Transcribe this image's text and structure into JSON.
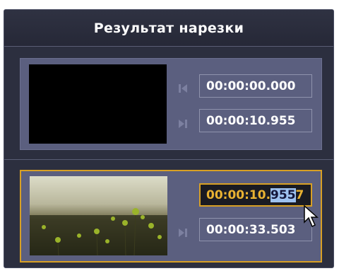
{
  "panel": {
    "title": "Результат нарезки"
  },
  "clips": [
    {
      "start": "00:00:00.000",
      "end": "00:00:10.955",
      "selected": false
    },
    {
      "start_before_selection": "00:00:10.",
      "start_selected": "955",
      "start_caret_char": "7",
      "end": "00:00:33.503",
      "selected": true
    }
  ],
  "icons": {
    "start": "skip-to-start-icon",
    "end": "skip-to-end-icon"
  },
  "colors": {
    "panel_bg": "#2c2f3f",
    "clip_bg": "#5b5f7f",
    "accent": "#d8a024",
    "selection": "#9ec2f0"
  }
}
